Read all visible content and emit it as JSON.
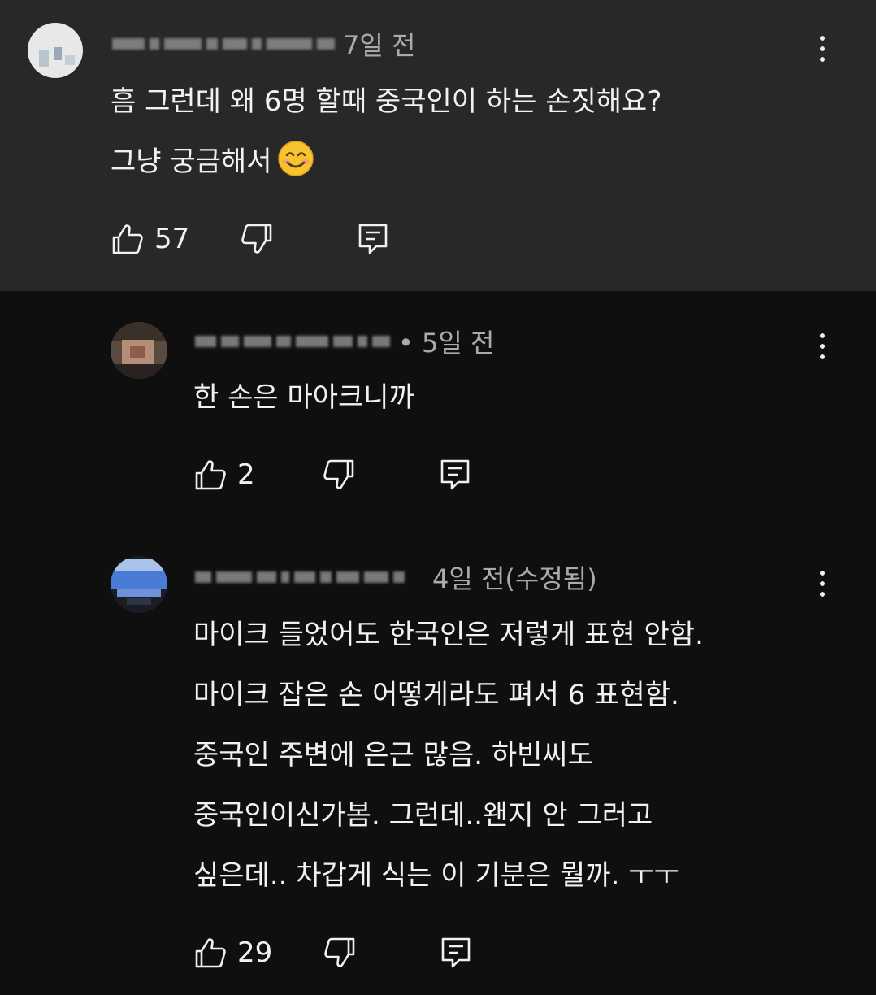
{
  "comments": [
    {
      "time": "7일 전",
      "lines": [
        "흠 그런데 왜 6명 할때 중국인이 하는 손짓해요?",
        "그냥 궁금해서"
      ],
      "emoji_icon": "smiling-face-emoji",
      "likes": "57"
    },
    {
      "time": "• 5일 전",
      "lines": [
        "한 손은 마아크니까"
      ],
      "likes": "2"
    },
    {
      "time": "4일 전(수정됨)",
      "lines": [
        "마이크 들었어도 한국인은 저렇게 표현 안함.",
        "마이크 잡은 손 어떻게라도 펴서 6 표현함.",
        "중국인 주변에 은근 많음. 하빈씨도",
        "중국인이신가봄. 그런데..왠지 안 그러고",
        "싶은데.. 차갑게 식는 이 기분은 뭘까. ㅜㅜ"
      ],
      "likes": "29"
    }
  ],
  "icons": {
    "like": "thumbs-up-icon",
    "dislike": "thumbs-down-icon",
    "reply": "reply-comment-icon",
    "menu": "more-vert-icon"
  },
  "colors": {
    "highlight_bg": "#282828",
    "page_bg": "#0f0f0f",
    "text": "#f1f1f1",
    "meta_text": "#aaaaaa"
  }
}
